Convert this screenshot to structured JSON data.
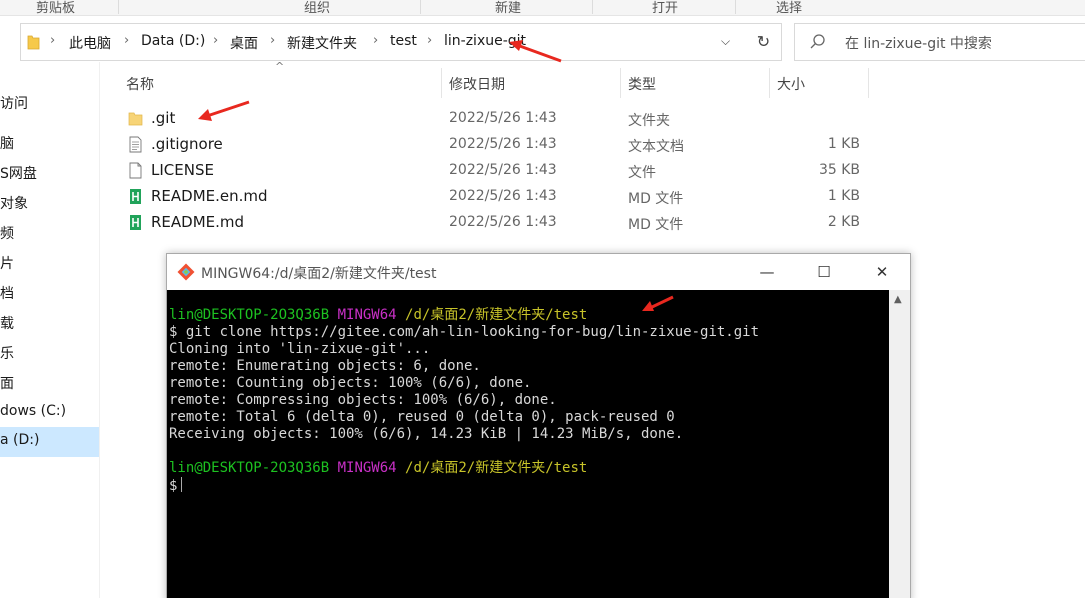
{
  "ribbon": {
    "groups": [
      "剪贴板",
      "组织",
      "新建",
      "打开",
      "选择"
    ]
  },
  "address": {
    "crumbs": [
      "此电脑",
      "Data (D:)",
      "桌面",
      "新建文件夹",
      "test",
      "lin-zixue-git"
    ]
  },
  "search": {
    "placeholder": "在 lin-zixue-git 中搜索"
  },
  "nav": {
    "items": [
      "访问",
      "脑",
      "S网盘",
      "对象",
      "频",
      "片",
      "档",
      "载",
      "乐",
      "面",
      "dows (C:)",
      "a (D:)"
    ]
  },
  "columns": {
    "name": "名称",
    "date": "修改日期",
    "type": "类型",
    "size": "大小"
  },
  "files": [
    {
      "name": ".git",
      "date": "2022/5/26 1:43",
      "type": "文件夹",
      "size": "",
      "icon": "folder-icon"
    },
    {
      "name": ".gitignore",
      "date": "2022/5/26 1:43",
      "type": "文本文档",
      "size": "1 KB",
      "icon": "text-file-icon"
    },
    {
      "name": "LICENSE",
      "date": "2022/5/26 1:43",
      "type": "文件",
      "size": "35 KB",
      "icon": "file-icon"
    },
    {
      "name": "README.en.md",
      "date": "2022/5/26 1:43",
      "type": "MD 文件",
      "size": "1 KB",
      "icon": "markdown-file-icon"
    },
    {
      "name": "README.md",
      "date": "2022/5/26 1:43",
      "type": "MD 文件",
      "size": "2 KB",
      "icon": "markdown-file-icon"
    }
  ],
  "terminal": {
    "title": "MINGW64:/d/桌面2/新建文件夹/test",
    "prompt_user": "lin@DESKTOP-2O3Q36B",
    "prompt_shell": "MINGW64",
    "prompt_path": "/d/桌面2/新建文件夹/test",
    "command": "$ git clone https://gitee.com/ah-lin-looking-for-bug/lin-zixue-git.git",
    "output": [
      "Cloning into 'lin-zixue-git'...",
      "remote: Enumerating objects: 6, done.",
      "remote: Counting objects: 100% (6/6), done.",
      "remote: Compressing objects: 100% (6/6), done.",
      "remote: Total 6 (delta 0), reused 0 (delta 0), pack-reused 0",
      "Receiving objects: 100% (6/6), 14.23 KiB | 14.23 MiB/s, done."
    ],
    "prompt2_user": "lin@DESKTOP-2O3Q36B",
    "prompt2_shell": "MINGW64",
    "prompt2_path": "/d/桌面2/新建文件夹/test",
    "input_prompt": "$",
    "minimize": "—",
    "maximize": "☐",
    "close": "✕"
  },
  "colors": {
    "green": "#1dc121",
    "magenta": "#c930c7",
    "yellow": "#c7c329",
    "annotation_red": "#e8281f",
    "selection": "#cce8ff"
  }
}
